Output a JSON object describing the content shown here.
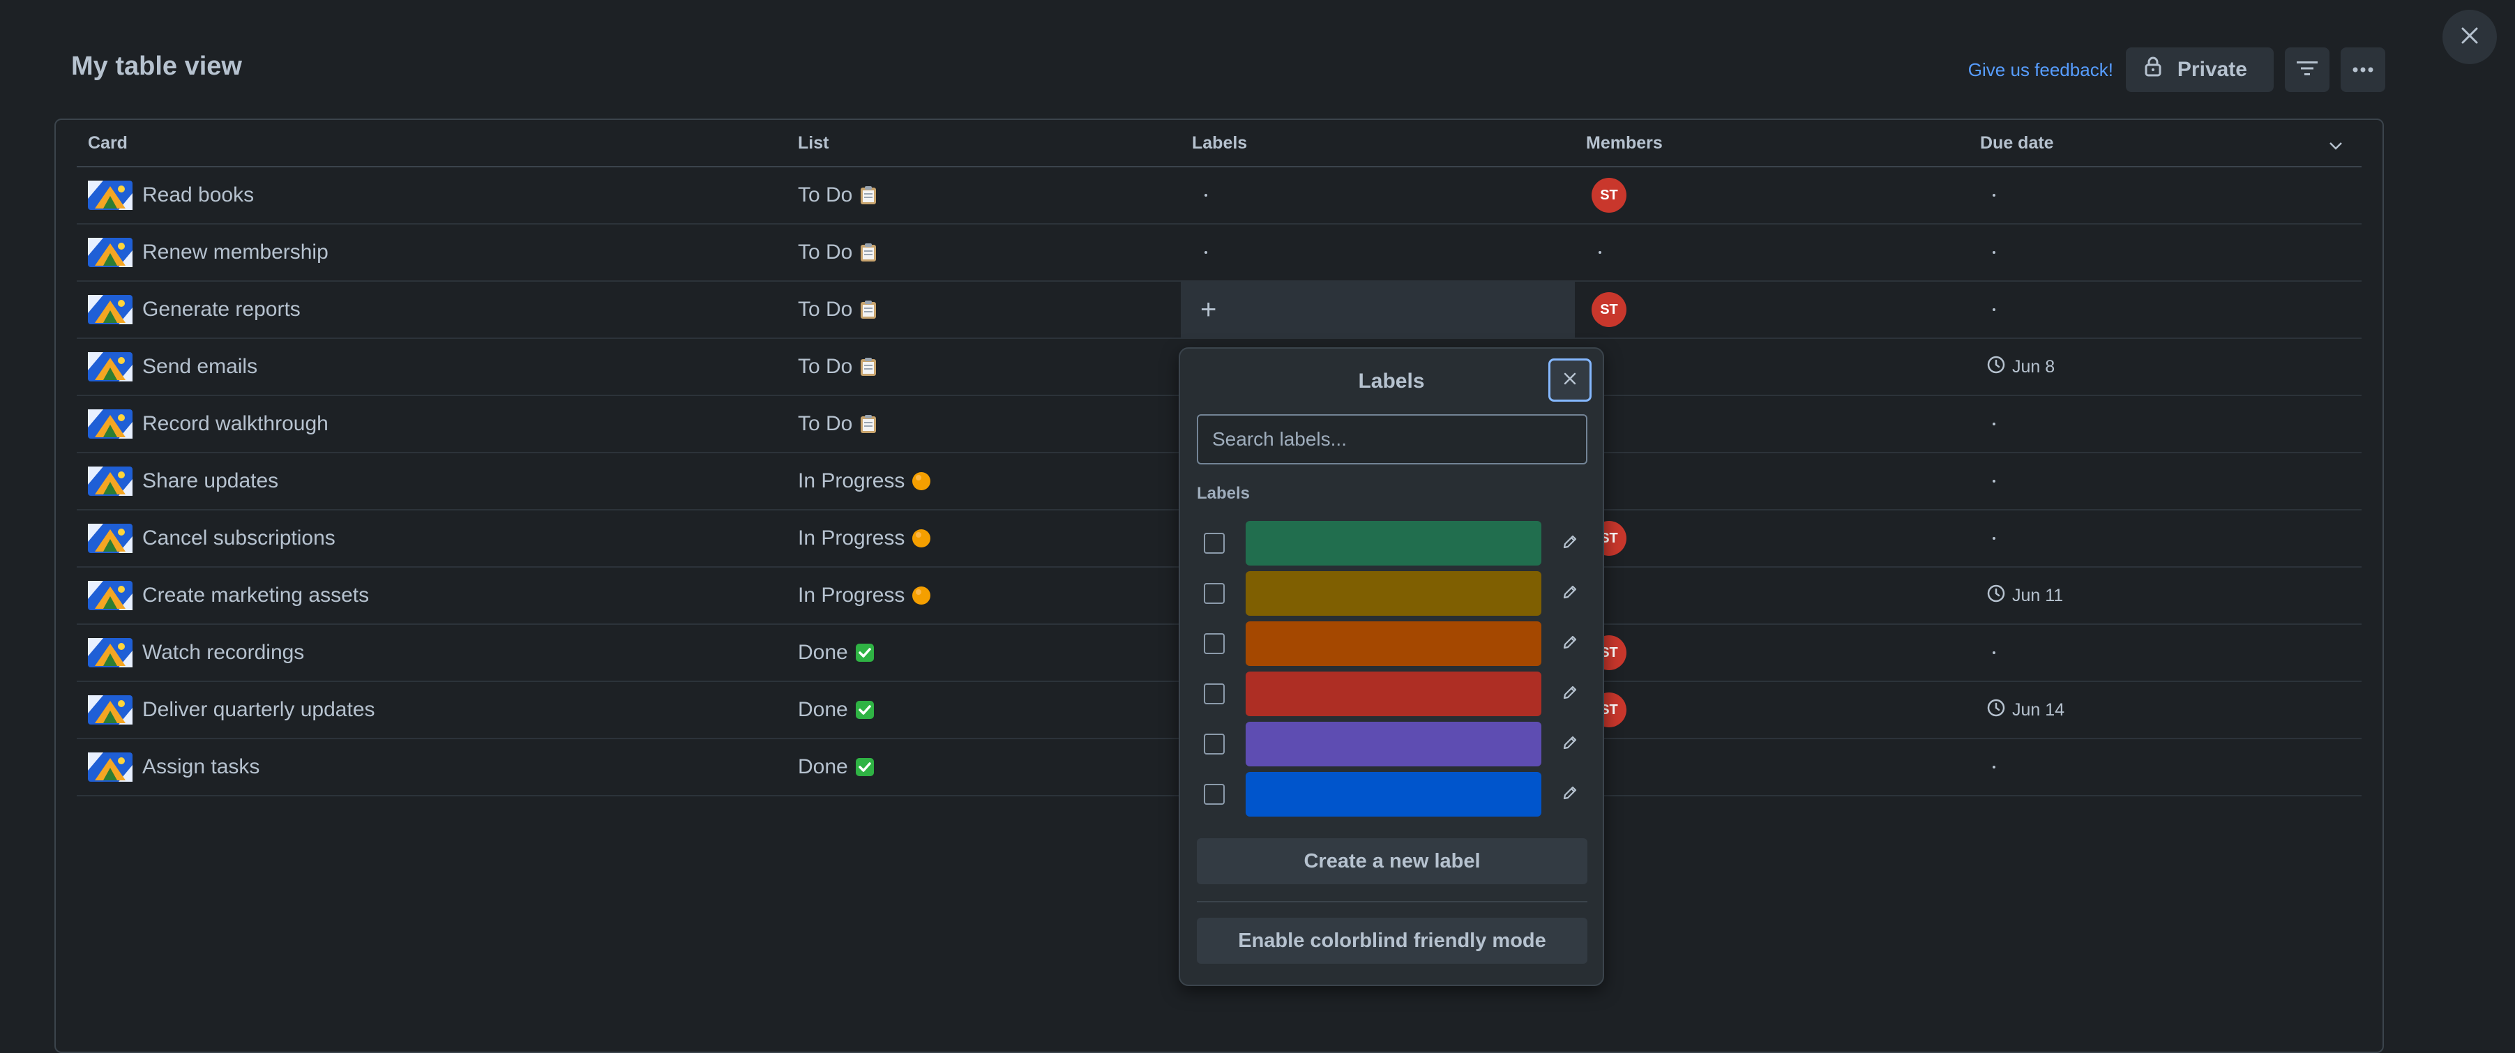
{
  "page": {
    "title": "My table view"
  },
  "header": {
    "feedback_link": "Give us feedback!",
    "private_button": "Private",
    "filter_icon": "filter-icon",
    "more_icon": "more-icon"
  },
  "table": {
    "columns": [
      "Card",
      "List",
      "Labels",
      "Members",
      "Due date"
    ],
    "rows": [
      {
        "card": "Read books",
        "list": "To Do",
        "list_emoji": "clipboard",
        "member": "ST",
        "due": ""
      },
      {
        "card": "Renew membership",
        "list": "To Do",
        "list_emoji": "clipboard",
        "member": "",
        "due": ""
      },
      {
        "card": "Generate reports",
        "list": "To Do",
        "list_emoji": "clipboard",
        "member": "ST",
        "due": ""
      },
      {
        "card": "Send emails",
        "list": "To Do",
        "list_emoji": "clipboard",
        "member": "",
        "due": "Jun 8"
      },
      {
        "card": "Record walkthrough",
        "list": "To Do",
        "list_emoji": "clipboard",
        "member": "",
        "due": ""
      },
      {
        "card": "Share updates",
        "list": "In Progress",
        "list_emoji": "orange-circle",
        "member": "",
        "due": ""
      },
      {
        "card": "Cancel subscriptions",
        "list": "In Progress",
        "list_emoji": "orange-circle",
        "member": "ST",
        "due": ""
      },
      {
        "card": "Create marketing assets",
        "list": "In Progress",
        "list_emoji": "orange-circle",
        "member": "",
        "due": "Jun 11"
      },
      {
        "card": "Watch recordings",
        "list": "Done",
        "list_emoji": "check-box",
        "member": "ST",
        "due": ""
      },
      {
        "card": "Deliver quarterly updates",
        "list": "Done",
        "list_emoji": "check-box",
        "member": "ST",
        "due": "Jun 14"
      },
      {
        "card": "Assign tasks",
        "list": "Done",
        "list_emoji": "check-box",
        "member": "",
        "due": ""
      }
    ]
  },
  "popover": {
    "title": "Labels",
    "search_placeholder": "Search labels...",
    "section_label": "Labels",
    "labels": [
      {
        "color": "#216e4e"
      },
      {
        "color": "#7f5f01"
      },
      {
        "color": "#a54800"
      },
      {
        "color": "#ae2e24"
      },
      {
        "color": "#5e4db2"
      },
      {
        "color": "#0055cc"
      }
    ],
    "create_button": "Create a new label",
    "colorblind_button": "Enable colorblind friendly mode"
  },
  "colors": {
    "background": "#1d2125",
    "avatar": "#c9372c",
    "link": "#579dff"
  }
}
